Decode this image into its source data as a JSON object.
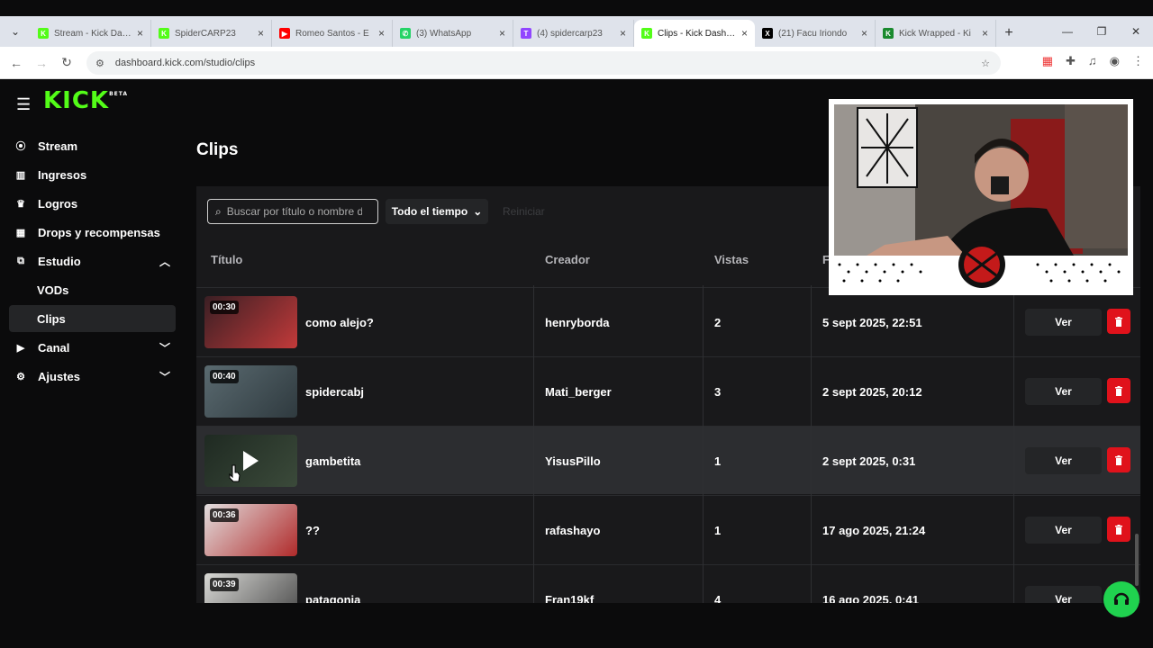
{
  "browser": {
    "tabs": [
      {
        "title": "Stream - Kick Dashboard",
        "fav_color": "#53fc18",
        "fav_glyph": "K"
      },
      {
        "title": "SpiderCARP23",
        "fav_color": "#53fc18",
        "fav_glyph": "K"
      },
      {
        "title": "Romeo Santos - E",
        "fav_color": "#ff0000",
        "fav_glyph": "▶"
      },
      {
        "title": "(3) WhatsApp",
        "fav_color": "#25d366",
        "fav_glyph": "✆"
      },
      {
        "title": "(4) spidercarp23",
        "fav_color": "#9146ff",
        "fav_glyph": "T"
      },
      {
        "title": "Clips - Kick Dashboard",
        "fav_color": "#53fc18",
        "fav_glyph": "K"
      },
      {
        "title": "(21) Facu Iriondo",
        "fav_color": "#000000",
        "fav_glyph": "X"
      },
      {
        "title": "Kick Wrapped - Ki",
        "fav_color": "#1a8a2e",
        "fav_glyph": "K"
      }
    ],
    "active_tab_index": 5,
    "url": "dashboard.kick.com/studio/clips"
  },
  "sidebar": {
    "logo": "KICK",
    "logo_badge": "BETA",
    "items": [
      {
        "label": "Stream",
        "icon": "broadcast-icon",
        "glyph": "((•))"
      },
      {
        "label": "Ingresos",
        "icon": "chart-icon",
        "glyph": "▥"
      },
      {
        "label": "Logros",
        "icon": "trophy-icon",
        "glyph": "🏆"
      },
      {
        "label": "Drops y recompensas",
        "icon": "gift-icon",
        "glyph": "▣"
      },
      {
        "label": "Estudio",
        "icon": "studio-icon",
        "glyph": "▣"
      },
      {
        "label": "VODs"
      },
      {
        "label": "Clips"
      },
      {
        "label": "Canal",
        "icon": "channel-icon",
        "glyph": "▶"
      },
      {
        "label": "Ajustes",
        "icon": "gear-icon",
        "glyph": "⚙"
      }
    ]
  },
  "page": {
    "title": "Clips",
    "search_placeholder": "Buscar por título o nombre de",
    "filter_label": "Todo el tiempo",
    "reset_label": "Reiniciar",
    "columns": [
      "Título",
      "Creador",
      "Vistas",
      "F"
    ],
    "rows": [
      {
        "duration": "00:30",
        "title": "como alejo?",
        "creator": "henryborda",
        "views": "2",
        "date": "5 sept 2025, 22:51",
        "action": "Ver"
      },
      {
        "duration": "00:40",
        "title": "spidercabj",
        "creator": "Mati_berger",
        "views": "3",
        "date": "2 sept 2025, 20:12",
        "action": "Ver"
      },
      {
        "duration": "",
        "title": "gambetita",
        "creator": "YisusPillo",
        "views": "1",
        "date": "2 sept 2025, 0:31",
        "action": "Ver"
      },
      {
        "duration": "00:36",
        "title": "??",
        "creator": "rafashayo",
        "views": "1",
        "date": "17 ago 2025, 21:24",
        "action": "Ver"
      },
      {
        "duration": "00:39",
        "title": "patagonia",
        "creator": "Fran19kf",
        "views": "4",
        "date": "16 ago 2025, 0:41",
        "action": "Ver"
      }
    ]
  },
  "colors": {
    "brand": "#53fc18",
    "danger": "#e0121b",
    "support": "#20d24f"
  }
}
